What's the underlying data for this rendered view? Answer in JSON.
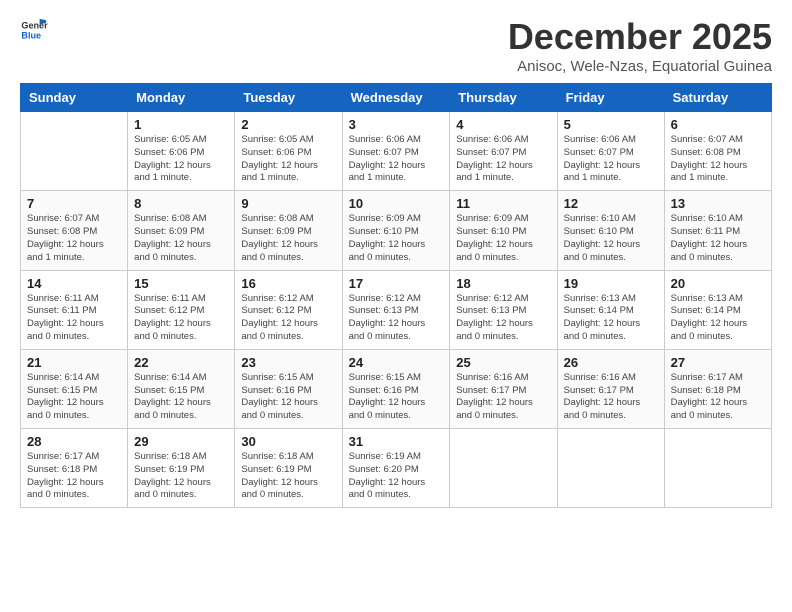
{
  "logo": {
    "line1": "General",
    "line2": "Blue"
  },
  "title": "December 2025",
  "subtitle": "Anisoc, Wele-Nzas, Equatorial Guinea",
  "weekdays": [
    "Sunday",
    "Monday",
    "Tuesday",
    "Wednesday",
    "Thursday",
    "Friday",
    "Saturday"
  ],
  "weeks": [
    [
      {
        "day": "",
        "info": ""
      },
      {
        "day": "1",
        "info": "Sunrise: 6:05 AM\nSunset: 6:06 PM\nDaylight: 12 hours\nand 1 minute."
      },
      {
        "day": "2",
        "info": "Sunrise: 6:05 AM\nSunset: 6:06 PM\nDaylight: 12 hours\nand 1 minute."
      },
      {
        "day": "3",
        "info": "Sunrise: 6:06 AM\nSunset: 6:07 PM\nDaylight: 12 hours\nand 1 minute."
      },
      {
        "day": "4",
        "info": "Sunrise: 6:06 AM\nSunset: 6:07 PM\nDaylight: 12 hours\nand 1 minute."
      },
      {
        "day": "5",
        "info": "Sunrise: 6:06 AM\nSunset: 6:07 PM\nDaylight: 12 hours\nand 1 minute."
      },
      {
        "day": "6",
        "info": "Sunrise: 6:07 AM\nSunset: 6:08 PM\nDaylight: 12 hours\nand 1 minute."
      }
    ],
    [
      {
        "day": "7",
        "info": "Sunrise: 6:07 AM\nSunset: 6:08 PM\nDaylight: 12 hours\nand 1 minute."
      },
      {
        "day": "8",
        "info": "Sunrise: 6:08 AM\nSunset: 6:09 PM\nDaylight: 12 hours\nand 0 minutes."
      },
      {
        "day": "9",
        "info": "Sunrise: 6:08 AM\nSunset: 6:09 PM\nDaylight: 12 hours\nand 0 minutes."
      },
      {
        "day": "10",
        "info": "Sunrise: 6:09 AM\nSunset: 6:10 PM\nDaylight: 12 hours\nand 0 minutes."
      },
      {
        "day": "11",
        "info": "Sunrise: 6:09 AM\nSunset: 6:10 PM\nDaylight: 12 hours\nand 0 minutes."
      },
      {
        "day": "12",
        "info": "Sunrise: 6:10 AM\nSunset: 6:10 PM\nDaylight: 12 hours\nand 0 minutes."
      },
      {
        "day": "13",
        "info": "Sunrise: 6:10 AM\nSunset: 6:11 PM\nDaylight: 12 hours\nand 0 minutes."
      }
    ],
    [
      {
        "day": "14",
        "info": "Sunrise: 6:11 AM\nSunset: 6:11 PM\nDaylight: 12 hours\nand 0 minutes."
      },
      {
        "day": "15",
        "info": "Sunrise: 6:11 AM\nSunset: 6:12 PM\nDaylight: 12 hours\nand 0 minutes."
      },
      {
        "day": "16",
        "info": "Sunrise: 6:12 AM\nSunset: 6:12 PM\nDaylight: 12 hours\nand 0 minutes."
      },
      {
        "day": "17",
        "info": "Sunrise: 6:12 AM\nSunset: 6:13 PM\nDaylight: 12 hours\nand 0 minutes."
      },
      {
        "day": "18",
        "info": "Sunrise: 6:12 AM\nSunset: 6:13 PM\nDaylight: 12 hours\nand 0 minutes."
      },
      {
        "day": "19",
        "info": "Sunrise: 6:13 AM\nSunset: 6:14 PM\nDaylight: 12 hours\nand 0 minutes."
      },
      {
        "day": "20",
        "info": "Sunrise: 6:13 AM\nSunset: 6:14 PM\nDaylight: 12 hours\nand 0 minutes."
      }
    ],
    [
      {
        "day": "21",
        "info": "Sunrise: 6:14 AM\nSunset: 6:15 PM\nDaylight: 12 hours\nand 0 minutes."
      },
      {
        "day": "22",
        "info": "Sunrise: 6:14 AM\nSunset: 6:15 PM\nDaylight: 12 hours\nand 0 minutes."
      },
      {
        "day": "23",
        "info": "Sunrise: 6:15 AM\nSunset: 6:16 PM\nDaylight: 12 hours\nand 0 minutes."
      },
      {
        "day": "24",
        "info": "Sunrise: 6:15 AM\nSunset: 6:16 PM\nDaylight: 12 hours\nand 0 minutes."
      },
      {
        "day": "25",
        "info": "Sunrise: 6:16 AM\nSunset: 6:17 PM\nDaylight: 12 hours\nand 0 minutes."
      },
      {
        "day": "26",
        "info": "Sunrise: 6:16 AM\nSunset: 6:17 PM\nDaylight: 12 hours\nand 0 minutes."
      },
      {
        "day": "27",
        "info": "Sunrise: 6:17 AM\nSunset: 6:18 PM\nDaylight: 12 hours\nand 0 minutes."
      }
    ],
    [
      {
        "day": "28",
        "info": "Sunrise: 6:17 AM\nSunset: 6:18 PM\nDaylight: 12 hours\nand 0 minutes."
      },
      {
        "day": "29",
        "info": "Sunrise: 6:18 AM\nSunset: 6:19 PM\nDaylight: 12 hours\nand 0 minutes."
      },
      {
        "day": "30",
        "info": "Sunrise: 6:18 AM\nSunset: 6:19 PM\nDaylight: 12 hours\nand 0 minutes."
      },
      {
        "day": "31",
        "info": "Sunrise: 6:19 AM\nSunset: 6:20 PM\nDaylight: 12 hours\nand 0 minutes."
      },
      {
        "day": "",
        "info": ""
      },
      {
        "day": "",
        "info": ""
      },
      {
        "day": "",
        "info": ""
      }
    ]
  ]
}
